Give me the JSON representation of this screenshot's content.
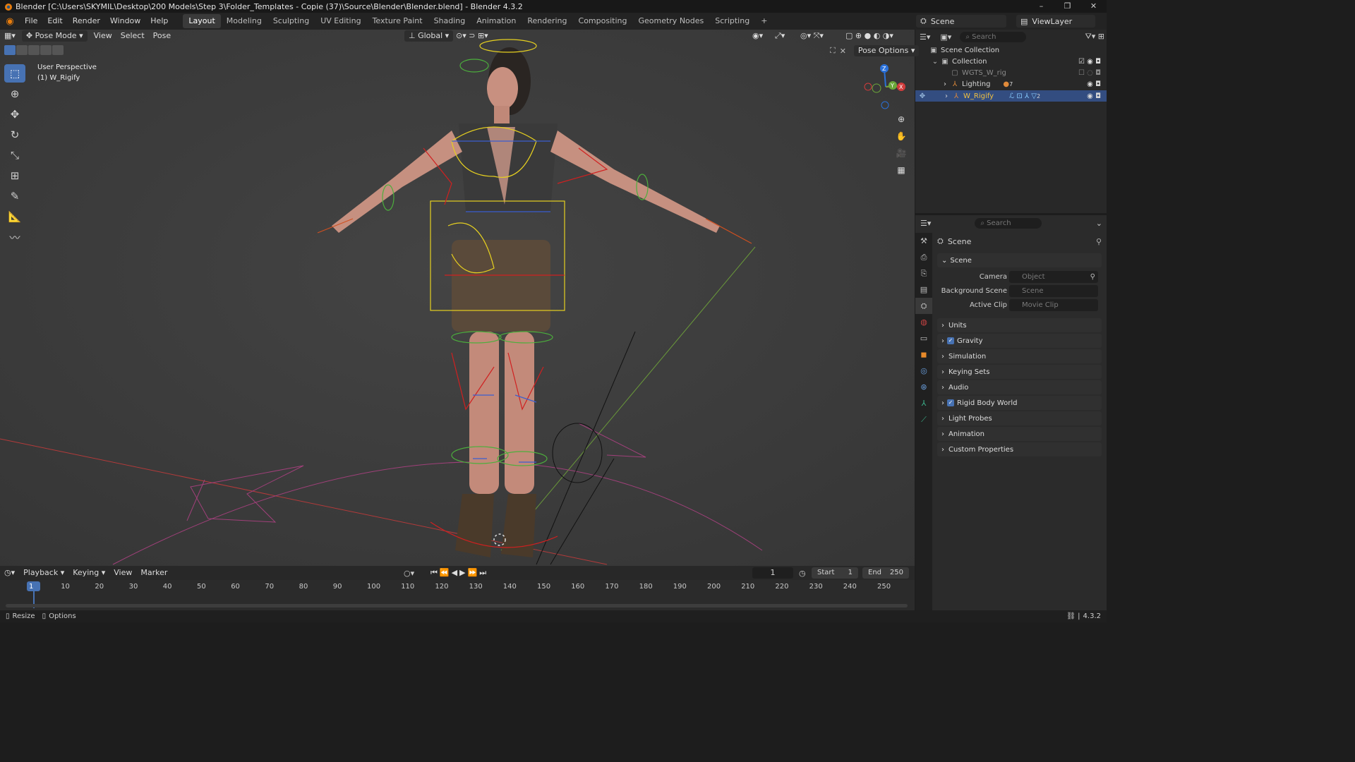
{
  "window": {
    "title": "Blender [C:\\Users\\SKYMIL\\Desktop\\200 Models\\Step 3\\Folder_Templates - Copie (37)\\Source\\Blender\\Blender.blend] - Blender 4.3.2",
    "minimize": "–",
    "maximize": "❐",
    "close": "✕"
  },
  "menu": [
    "File",
    "Edit",
    "Render",
    "Window",
    "Help"
  ],
  "workspaces": [
    "Layout",
    "Modeling",
    "Sculpting",
    "UV Editing",
    "Texture Paint",
    "Shading",
    "Animation",
    "Rendering",
    "Compositing",
    "Geometry Nodes",
    "Scripting",
    "+"
  ],
  "scene_selector": "Scene",
  "view_layer": "ViewLayer",
  "viewport": {
    "mode": "Pose Mode",
    "menus": [
      "View",
      "Select",
      "Pose"
    ],
    "orientation": "Global",
    "pose_options": "Pose Options",
    "info_line1": "User Perspective",
    "info_line2": "(1) W_Rigify",
    "gizmo_axes": {
      "x": "X",
      "y": "Y",
      "z": "Z"
    }
  },
  "outliner": {
    "search_placeholder": "Search",
    "scene_collection": "Scene Collection",
    "collection": "Collection",
    "items": [
      "WGTS_W_rig",
      "Lighting",
      "W_Rigify"
    ],
    "lighting_badge": "7",
    "rig_badge": "2"
  },
  "properties": {
    "search_placeholder": "Search",
    "context": "Scene",
    "panel_scene": "Scene",
    "camera_label": "Camera",
    "camera_placeholder": "Object",
    "background_label": "Background Scene",
    "background_placeholder": "Scene",
    "clip_label": "Active Clip",
    "clip_placeholder": "Movie Clip",
    "panels": [
      "Units",
      "Gravity",
      "Simulation",
      "Keying Sets",
      "Audio",
      "Rigid Body World",
      "Light Probes",
      "Animation",
      "Custom Properties"
    ]
  },
  "timeline": {
    "menus": [
      "Playback",
      "Keying",
      "View",
      "Marker"
    ],
    "current_frame": "1",
    "start_label": "Start",
    "start": "1",
    "end_label": "End",
    "end": "250",
    "ticks": [
      "1",
      "10",
      "20",
      "30",
      "40",
      "50",
      "60",
      "70",
      "80",
      "90",
      "100",
      "110",
      "120",
      "130",
      "140",
      "150",
      "160",
      "170",
      "180",
      "190",
      "200",
      "210",
      "220",
      "230",
      "240",
      "250"
    ]
  },
  "status": {
    "left1": "Resize",
    "left2": "Options",
    "version": "4.3.2"
  },
  "colors": {
    "accent": "#4772b3",
    "viewport_bg": "#3a3a3a",
    "rig_yellow": "#e6d020",
    "rig_red": "#d02020",
    "rig_green": "#4caf3c",
    "rig_blue": "#3a5ed0"
  }
}
